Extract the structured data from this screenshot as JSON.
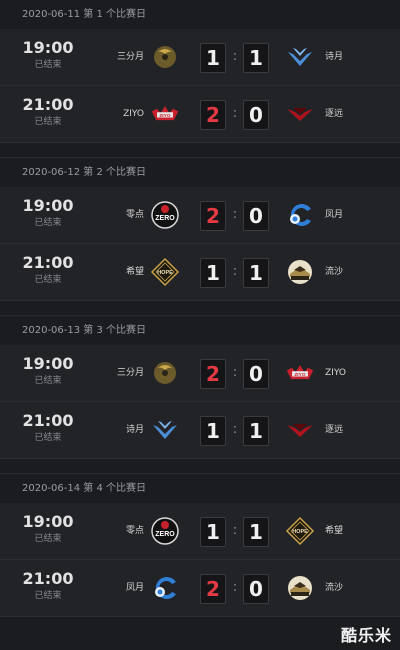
{
  "days": [
    {
      "header": "2020-06-11 第 1 个比赛日",
      "matches": [
        {
          "time": "19:00",
          "status": "已结束",
          "left_team": "三分月",
          "left_logo": "sanfenyue-logo",
          "left_score": "1",
          "right_score": "1",
          "right_team": "诗月",
          "right_logo": "shiyue-logo",
          "left_win": false,
          "right_win": false
        },
        {
          "time": "21:00",
          "status": "已结束",
          "left_team": "ZIYO",
          "left_logo": "ziyo-logo",
          "left_score": "2",
          "right_score": "0",
          "right_team": "逐远",
          "right_logo": "zhuyuan-logo",
          "left_win": true,
          "right_win": false
        }
      ]
    },
    {
      "header": "2020-06-12 第 2 个比赛日",
      "matches": [
        {
          "time": "19:00",
          "status": "已结束",
          "left_team": "零点",
          "left_logo": "zero-logo",
          "left_score": "2",
          "right_score": "0",
          "right_team": "凤月",
          "right_logo": "fengyue-logo",
          "left_win": true,
          "right_win": false
        },
        {
          "time": "21:00",
          "status": "已结束",
          "left_team": "希望",
          "left_logo": "hope-logo",
          "left_score": "1",
          "right_score": "1",
          "right_team": "流沙",
          "right_logo": "liusha-logo",
          "left_win": false,
          "right_win": false
        }
      ]
    },
    {
      "header": "2020-06-13 第 3 个比赛日",
      "matches": [
        {
          "time": "19:00",
          "status": "已结束",
          "left_team": "三分月",
          "left_logo": "sanfenyue-logo",
          "left_score": "2",
          "right_score": "0",
          "right_team": "ZIYO",
          "right_logo": "ziyo-logo",
          "left_win": true,
          "right_win": false
        },
        {
          "time": "21:00",
          "status": "已结束",
          "left_team": "诗月",
          "left_logo": "shiyue-logo",
          "left_score": "1",
          "right_score": "1",
          "right_team": "逐远",
          "right_logo": "zhuyuan-logo",
          "left_win": false,
          "right_win": false
        }
      ]
    },
    {
      "header": "2020-06-14 第 4 个比赛日",
      "matches": [
        {
          "time": "19:00",
          "status": "已结束",
          "left_team": "零点",
          "left_logo": "zero-logo",
          "left_score": "1",
          "right_score": "1",
          "right_team": "希望",
          "right_logo": "hope-logo",
          "left_win": false,
          "right_win": false
        },
        {
          "time": "21:00",
          "status": "已结束",
          "left_team": "凤月",
          "left_logo": "fengyue-logo",
          "left_score": "2",
          "right_score": "0",
          "right_team": "流沙",
          "right_logo": "liusha-logo",
          "left_win": true,
          "right_win": false
        }
      ]
    }
  ],
  "colors": {
    "win_score": "#e53a43",
    "normal_score": "#f0f0f0",
    "background": "#1b1c20",
    "row": "#222327"
  },
  "watermark": "酷乐米"
}
